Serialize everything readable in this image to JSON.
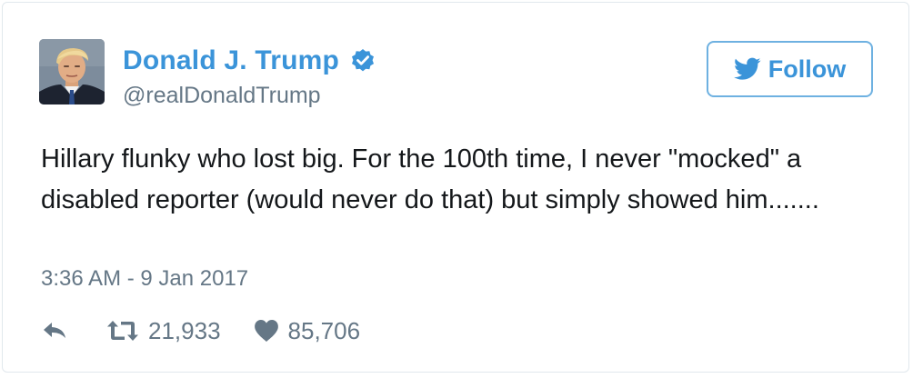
{
  "user": {
    "display_name": "Donald J. Trump",
    "handle": "@realDonaldTrump",
    "verified": true
  },
  "follow_button": {
    "label": "Follow",
    "icon": "twitter-bird-icon"
  },
  "tweet": {
    "text": "Hillary flunky who lost big. For the 100th time, I never \"mocked\" a disabled reporter (would never do that) but simply showed him.......",
    "timestamp": "3:36 AM - 9 Jan 2017"
  },
  "actions": {
    "reply_icon": "reply-icon",
    "retweet_icon": "retweet-icon",
    "retweet_count": "21,933",
    "like_icon": "heart-icon",
    "like_count": "85,706"
  },
  "colors": {
    "accent": "#3b94d9",
    "follow_border": "#6eb1e1",
    "text": "#14171a",
    "muted": "#657786",
    "border": "#e1e8ed",
    "verified_badge": "#3b94d9"
  }
}
